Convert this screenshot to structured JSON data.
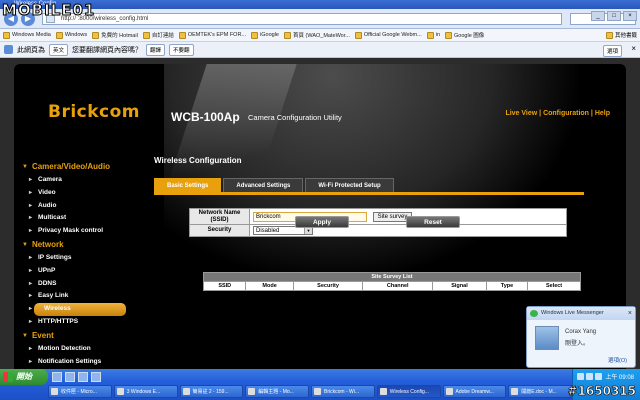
{
  "watermark": {
    "top": "MOBILE01",
    "bottom": "#1650315"
  },
  "browser": {
    "title": "Wireless Config",
    "url": "http://            :8000/wireless_config.html",
    "bookmarks": [
      "Windows Media",
      "Windows",
      "免費的 Hotmail",
      "自訂連結",
      "OEMTEK's EPM FOR...",
      "iGoogle",
      "首頁 (WAO_MateWor...",
      "Official Google Webm...",
      "in",
      "Google 圖像"
    ],
    "other_bookmarks": "其他書籤"
  },
  "translate_bar": {
    "label": "此網頁為",
    "language": "英文",
    "question": "您要翻譯網頁內容嗎？",
    "translate_button": "翻譯",
    "no_button": "不要翻",
    "options_button": "選項",
    "close": "×"
  },
  "header": {
    "logo": "Brickcom",
    "model": "WCB-100Ap",
    "subtitle": "Camera Configuration Utility",
    "links": [
      "Live View",
      "Configuration",
      "Help"
    ]
  },
  "sidebar": {
    "sections": [
      {
        "title": "Camera/Video/Audio",
        "items": [
          "Camera",
          "Video",
          "Audio",
          "Multicast",
          "Privacy Mask control"
        ]
      },
      {
        "title": "Network",
        "items": [
          "IP Settings",
          "UPnP",
          "DDNS",
          "Easy Link",
          "Wireless",
          "HTTP/HTTPS"
        ]
      },
      {
        "title": "Event",
        "items": [
          "Motion Detection",
          "Notification Settings"
        ]
      }
    ],
    "active_item": "Wireless"
  },
  "content": {
    "title": "Wireless Configuration",
    "tabs": [
      "Basic Settings",
      "Advanced Settings",
      "Wi-Fi Protected Setup"
    ],
    "active_tab": "Basic Settings",
    "network_name_label": "Network Name (SSID)",
    "network_name_value": "Brickcom",
    "site_survey_button": "Site survey",
    "security_label": "Security",
    "security_value": "Disabled",
    "apply_button": "Apply",
    "reset_button": "Reset",
    "survey_list": {
      "caption": "Site Survey List",
      "columns": [
        "SSID",
        "Mode",
        "Security",
        "Channel",
        "Signal",
        "Type",
        "Select"
      ]
    }
  },
  "messenger": {
    "title": "Windows Live Messenger",
    "contact": "Corax Yang",
    "status": "剛登入。",
    "options": "選項(O)"
  },
  "taskbar": {
    "start": "開始",
    "tasks": [
      "收件匣 - Micro...",
      "3 Windows E...",
      "簡易註 2 - 159...",
      "編輯主題 - Mo...",
      "Brickcom - Wi...",
      "Wireless Config...",
      "Adobe Dreamw...",
      "開啟E.doc - M..."
    ],
    "active_task": "Wireless Config...",
    "time": "上午 09:08"
  }
}
